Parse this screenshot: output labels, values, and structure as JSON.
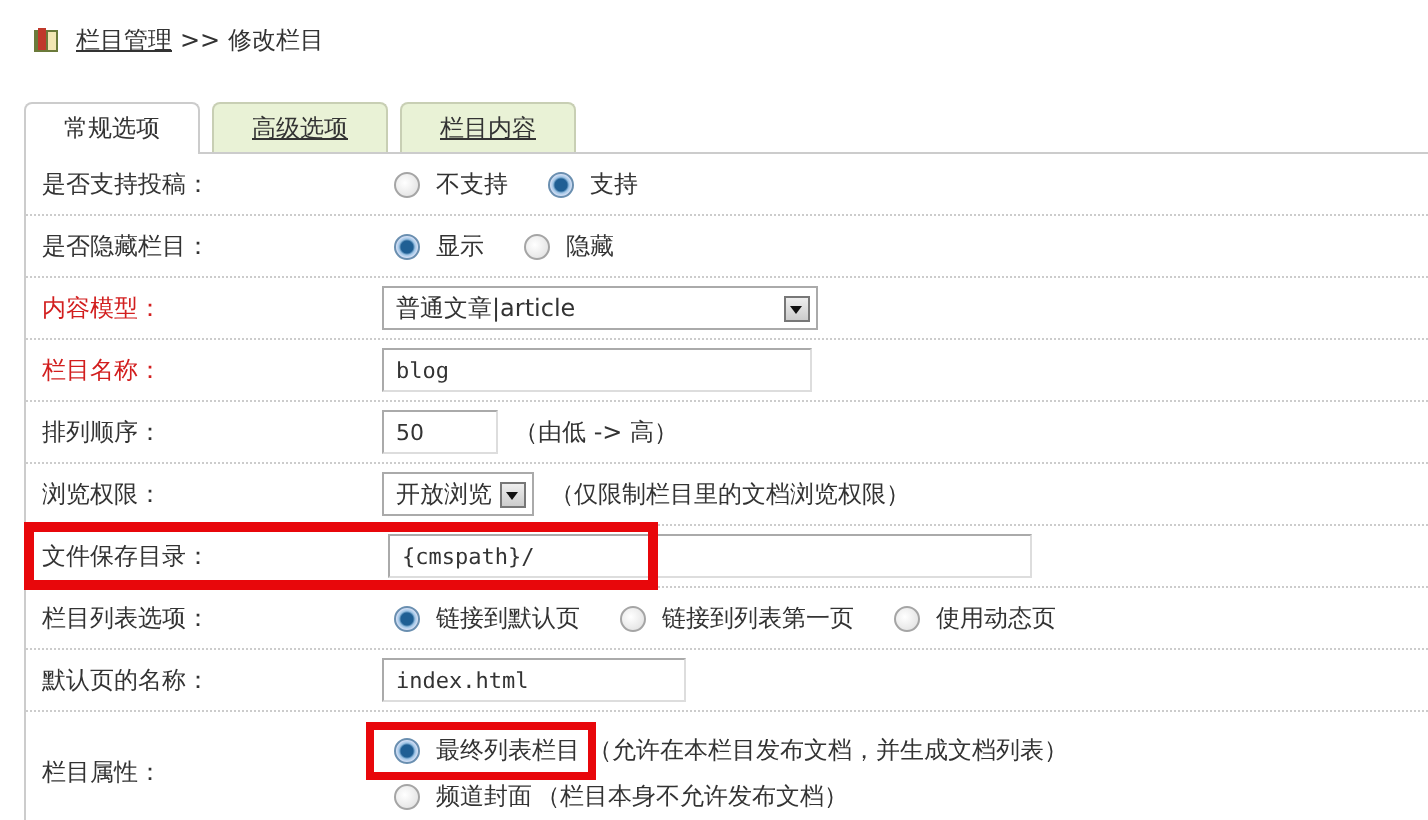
{
  "breadcrumb": {
    "link": "栏目管理",
    "separator": ">>",
    "current": "修改栏目"
  },
  "tabs": [
    {
      "label": "常规选项",
      "selected": true
    },
    {
      "label": "高级选项",
      "selected": false
    },
    {
      "label": "栏目内容",
      "selected": false
    }
  ],
  "fields": [
    {
      "label": "是否支持投稿：",
      "required": false,
      "kind": "radio",
      "options": [
        {
          "label": "不支持",
          "selected": false
        },
        {
          "label": "支持",
          "selected": true
        }
      ]
    },
    {
      "label": "是否隐藏栏目：",
      "required": false,
      "kind": "radio",
      "options": [
        {
          "label": "显示",
          "selected": true
        },
        {
          "label": "隐藏",
          "selected": false
        }
      ]
    },
    {
      "label": "内容模型：",
      "required": true,
      "kind": "select",
      "value": "普通文章|article"
    },
    {
      "label": "栏目名称：",
      "required": true,
      "kind": "text",
      "value": "blog"
    },
    {
      "label": "排列顺序：",
      "required": false,
      "kind": "text",
      "value": "50",
      "hint": "（由低 -> 高）"
    },
    {
      "label": "浏览权限：",
      "required": false,
      "kind": "select",
      "value": "开放浏览",
      "hint": "（仅限制栏目里的文档浏览权限）"
    },
    {
      "label": "文件保存目录：",
      "required": false,
      "kind": "text",
      "value": "{cmspath}/",
      "highlighted": true
    },
    {
      "label": "栏目列表选项：",
      "required": false,
      "kind": "radio",
      "options": [
        {
          "label": "链接到默认页",
          "selected": true
        },
        {
          "label": "链接到列表第一页",
          "selected": false
        },
        {
          "label": "使用动态页",
          "selected": false
        }
      ]
    },
    {
      "label": "默认页的名称：",
      "required": false,
      "kind": "text",
      "value": "index.html"
    },
    {
      "label": "栏目属性：",
      "required": false,
      "kind": "radio_stack",
      "options": [
        {
          "label": "最终列表栏目",
          "selected": true,
          "highlighted": true,
          "note": "（允许在本栏目发布文档，并生成文档列表）"
        },
        {
          "label": "频道封面",
          "selected": false,
          "note": "（栏目本身不允许发布文档）"
        }
      ]
    }
  ]
}
